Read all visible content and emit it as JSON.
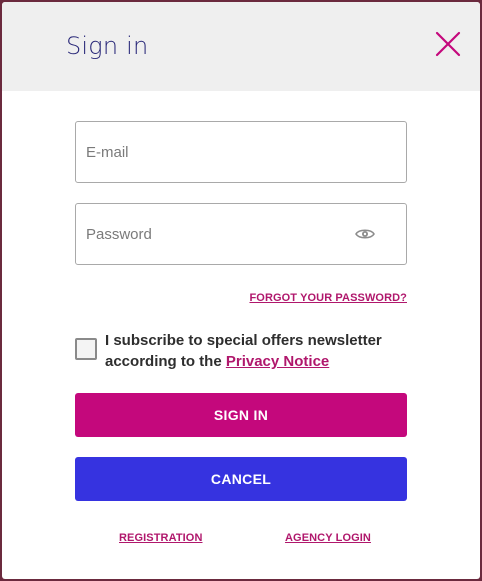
{
  "dialog": {
    "title": "Sign in",
    "close_icon": "close-icon"
  },
  "form": {
    "email": {
      "placeholder": "E-mail",
      "value": ""
    },
    "password": {
      "placeholder": "Password",
      "value": "",
      "toggle_icon": "eye-icon"
    },
    "forgot_password_label": "FORGOT YOUR PASSWORD?",
    "newsletter": {
      "checked": false,
      "text": "I subscribe to special offers newsletter according to the",
      "link_label": "Privacy Notice"
    },
    "sign_in_label": "SIGN IN",
    "cancel_label": "CANCEL"
  },
  "footer": {
    "registration_label": "REGISTRATION",
    "agency_login_label": "AGENCY LOGIN"
  },
  "colors": {
    "title": "#2b2a7a",
    "accent": "#c4087c",
    "cancel": "#3633e0",
    "link": "#b0176c",
    "header_bg": "#efefef"
  }
}
